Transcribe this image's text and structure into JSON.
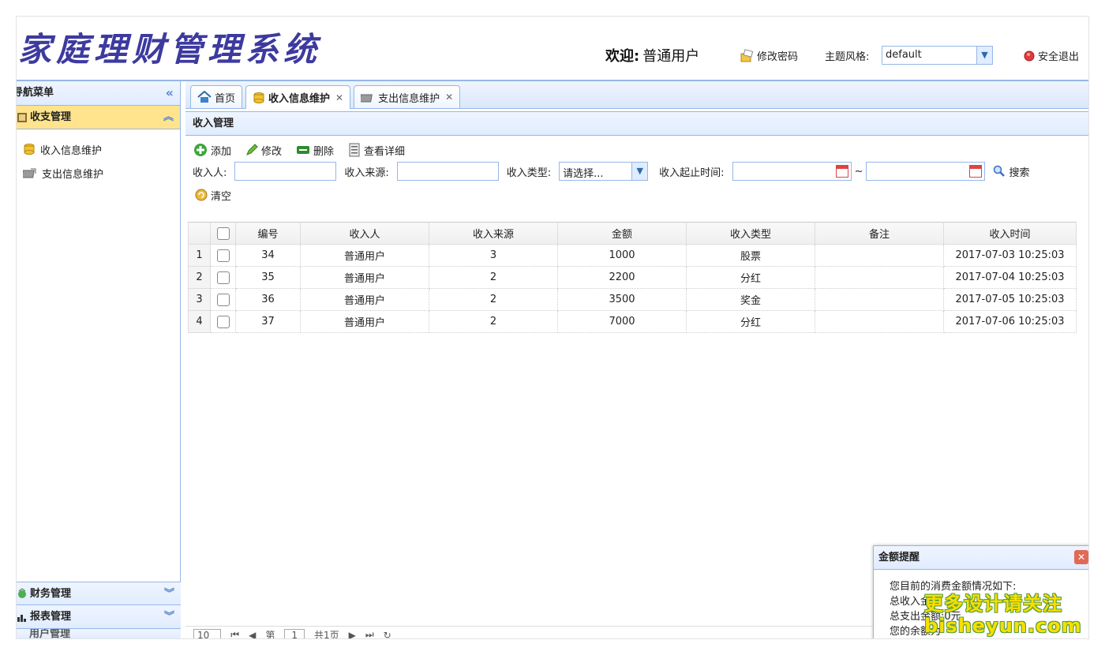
{
  "header": {
    "logo_text": "家庭理财管理系统",
    "welcome_label": "欢迎:",
    "welcome_user": "普通用户",
    "change_password": "修改密码",
    "theme_label": "主题风格:",
    "theme_value": "default",
    "logout": "安全退出"
  },
  "sidebar": {
    "title": "导航菜单",
    "active_group": "收支管理",
    "items": [
      "收入信息维护",
      "支出信息维护"
    ],
    "closed_groups": [
      "财务管理",
      "报表管理",
      "用户管理"
    ]
  },
  "tabs": [
    {
      "label": "首页"
    },
    {
      "label": "收入信息维护"
    },
    {
      "label": "支出信息维护"
    }
  ],
  "panel": {
    "title": "收入管理",
    "toolbar": {
      "add": "添加",
      "edit": "修改",
      "delete": "删除",
      "detail": "查看详细"
    },
    "search": {
      "earner_label": "收入人:",
      "source_label": "收入来源:",
      "type_label": "收入类型:",
      "type_value": "请选择...",
      "time_label": "收入起止时间:",
      "tilde": "~",
      "search_btn": "搜索",
      "clear_btn": "清空"
    }
  },
  "grid": {
    "columns": [
      "编号",
      "收入人",
      "收入来源",
      "金额",
      "收入类型",
      "备注",
      "收入时间"
    ],
    "rows": [
      {
        "n": "1",
        "id": "34",
        "earner": "普通用户",
        "source": "3",
        "amount": "1000",
        "type": "股票",
        "note": "",
        "time": "2017-07-03 10:25:03"
      },
      {
        "n": "2",
        "id": "35",
        "earner": "普通用户",
        "source": "2",
        "amount": "2200",
        "type": "分红",
        "note": "",
        "time": "2017-07-04 10:25:03"
      },
      {
        "n": "3",
        "id": "36",
        "earner": "普通用户",
        "source": "2",
        "amount": "3500",
        "type": "奖金",
        "note": "",
        "time": "2017-07-05 10:25:03"
      },
      {
        "n": "4",
        "id": "37",
        "earner": "普通用户",
        "source": "2",
        "amount": "7000",
        "type": "分红",
        "note": "",
        "time": "2017-07-06 10:25:03"
      }
    ]
  },
  "pager": {
    "page_size": "10",
    "page_prefix": "第",
    "page_value": "1",
    "page_total": "共1页"
  },
  "popup": {
    "title": "金额提醒",
    "line1": "您目前的消费金额情况如下:",
    "line2": "总收入金",
    "line3": "总支出金额:0元",
    "line4": "您的余额为"
  },
  "watermark": {
    "line1": "更多设计请关注",
    "line2": "bisheyun.com"
  },
  "colors": {
    "accent_border": "#95b8e7",
    "active_header": "#ffe48d",
    "logo": "#3d3a9f"
  }
}
